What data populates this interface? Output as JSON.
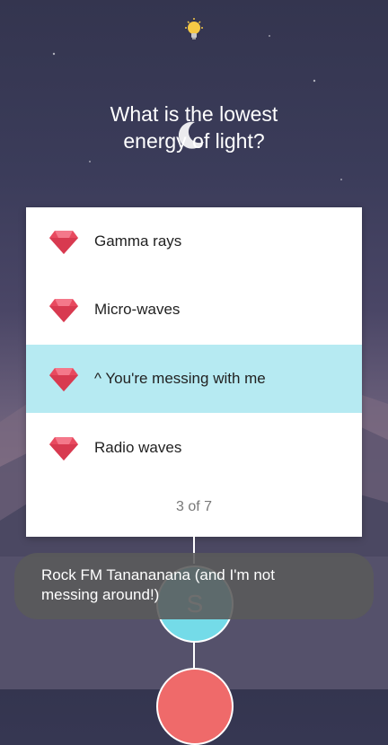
{
  "question": {
    "line1": "What is the lowest",
    "line2": "energy of light?"
  },
  "answers": [
    {
      "label": "Gamma rays",
      "selected": false
    },
    {
      "label": "Micro-waves",
      "selected": false
    },
    {
      "label": "^ You're messing with me",
      "selected": true
    },
    {
      "label": "Radio waves",
      "selected": false
    }
  ],
  "progress": "3 of 7",
  "path_node_letter": "S",
  "toast": {
    "line1": "Rock FM Tanananana (and I'm not",
    "line2": "messing around!)"
  },
  "colors": {
    "selected_answer_bg": "#b6eaf2",
    "gem": "#e84a5f",
    "node_cyan": "#74dbe8",
    "node_red": "#ef6a6a"
  },
  "icons": {
    "hint": "lightbulb-icon",
    "answer_marker": "gem-icon",
    "decoration": "moon-icon"
  }
}
